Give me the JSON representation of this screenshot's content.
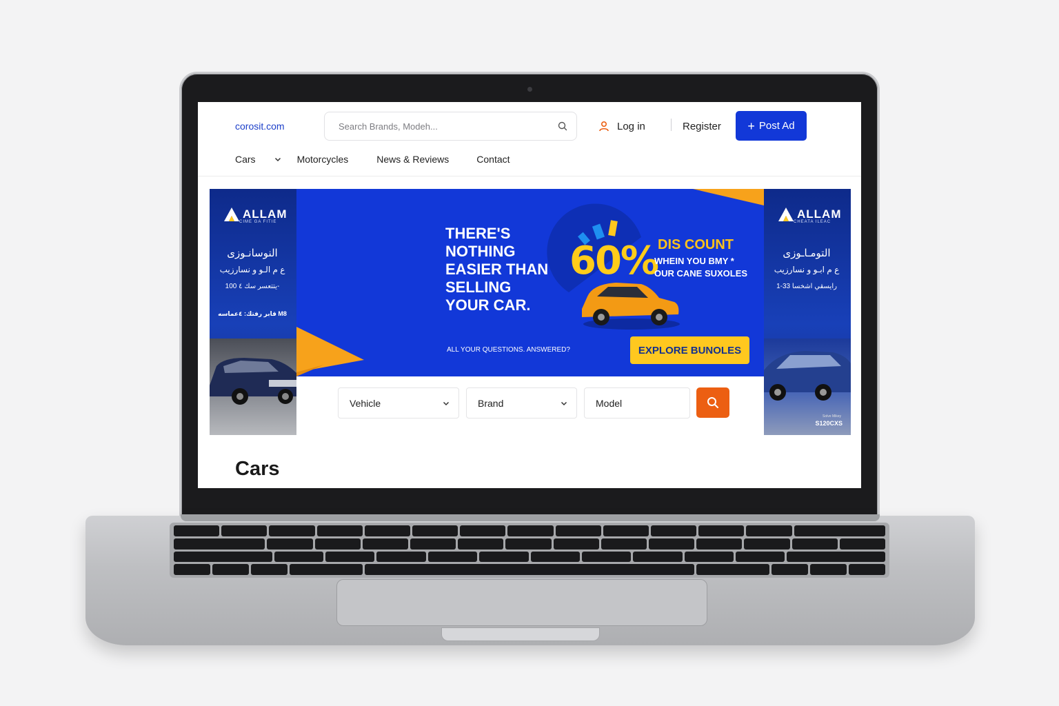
{
  "site": {
    "logo_text": "corosit.com",
    "search_placeholder": "Search Brands, Modeh...",
    "login_label": "Log in",
    "register_label": "Register",
    "post_ad_label": "Post Ad"
  },
  "nav": {
    "items": [
      {
        "label": "Cars",
        "has_dropdown": true
      },
      {
        "label": "Motorcycles"
      },
      {
        "label": "News & Reviews"
      },
      {
        "label": "Contact"
      }
    ]
  },
  "left_ad": {
    "brand": "ALLAM",
    "brand_sub": "CIME GA FITIE",
    "lines": [
      "النوسانـوزى",
      "ع م الـو و نسارزيب",
      "يتتعسر سك ٤ 100-",
      "قابر رفتك: ٤عماسه M8"
    ]
  },
  "right_ad": {
    "brand": "ALLAM",
    "brand_sub": "CHEATA ILEAC",
    "lines": [
      "التومـاـوزى",
      "ع م ابـو و نسارزيب",
      "رايسقي اشخسا 33-1"
    ],
    "model_sub": "Solve Mikey",
    "model": "S120CXS"
  },
  "hero": {
    "title": "THERE'S\nNOTHING\nEASIER THAN\nSELLING\nYOUR CAR.",
    "percent": "60%",
    "discount_title": "DIS COUNT",
    "discount_line1": "WHEIN YOU BMY *",
    "discount_line2": "OUR CANE SUXOLES",
    "question": "ALL YOUR QUESTIONS. ANSWERED?",
    "cta": "EXPLORE BUNOLES"
  },
  "filters": {
    "vehicle": "Vehicle",
    "brand": "Brand",
    "model": "Model"
  },
  "section_title": "Cars",
  "colors": {
    "brand_blue": "#1238d8",
    "accent_orange": "#ec5f12",
    "cta_yellow": "#ffc81f"
  }
}
